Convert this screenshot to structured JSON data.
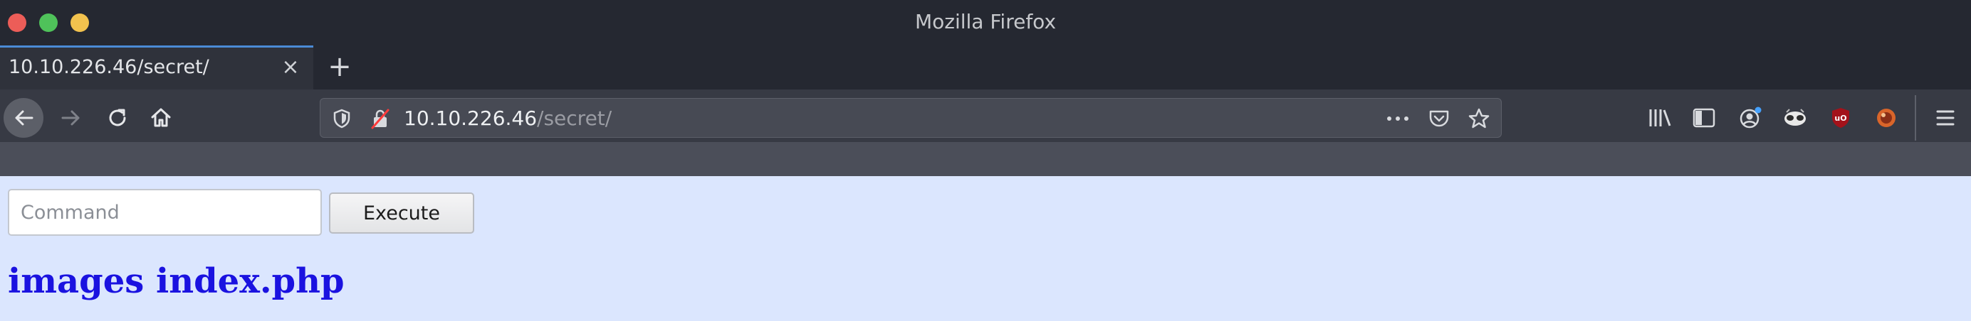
{
  "window": {
    "title": "Mozilla Firefox"
  },
  "tabs": [
    {
      "title": "10.10.226.46/secret/",
      "active": true
    }
  ],
  "toolbar": {
    "url_host": "10.10.226.46",
    "url_path": "/secret/",
    "icons": [
      "back-icon",
      "forward-icon",
      "reload-icon",
      "home-icon",
      "shield-icon",
      "insecure-lock-icon",
      "more-icon",
      "pocket-icon",
      "bookmark-star-icon",
      "library-icon",
      "sidebar-icon",
      "account-icon",
      "extension-icon",
      "ublock-icon",
      "extension-icon",
      "menu-icon"
    ]
  },
  "page": {
    "command_placeholder": "Command",
    "command_value": "",
    "execute_label": "Execute",
    "listing_text": "images index.php"
  },
  "colors": {
    "page_background": "#dbe6fe",
    "listing_link": "#1a12e0",
    "tab_accent": "#4b8bd6"
  }
}
